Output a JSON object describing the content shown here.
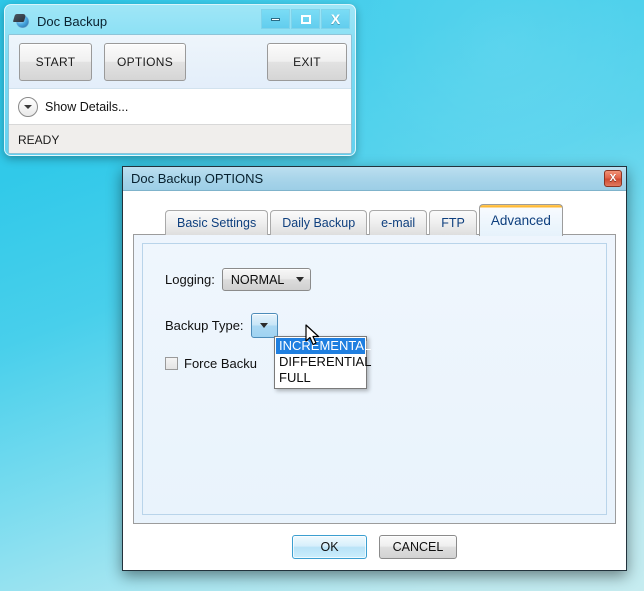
{
  "desktop": {
    "background_top_color": "#2ec7e8",
    "background_bottom_color": "#c6ecf0"
  },
  "main_window": {
    "title": "Doc Backup",
    "icon": "disc-backup-icon",
    "controls": {
      "minimize_label": "Minimize",
      "maximize_label": "Maximize",
      "close_label": "X"
    },
    "buttons": {
      "start": "START",
      "options": "OPTIONS",
      "exit": "EXIT"
    },
    "details_toggle": "Show Details...",
    "status": "READY"
  },
  "options_dialog": {
    "title": "Doc Backup OPTIONS",
    "close_label": "X",
    "tabs": [
      {
        "label": "Basic Settings",
        "active": false
      },
      {
        "label": "Daily Backup",
        "active": false
      },
      {
        "label": "e-mail",
        "active": false
      },
      {
        "label": "FTP",
        "active": false
      },
      {
        "label": "Advanced",
        "active": true
      }
    ],
    "active_tab_accent_color": "#ffb223",
    "fields": {
      "logging_label": "Logging:",
      "logging_value": "NORMAL",
      "backup_type_label": "Backup Type:",
      "backup_type_value": "",
      "force_backup_label": "Force Backu",
      "force_backup_checked": false
    },
    "dropdown": {
      "open": true,
      "highlight_color": "#1f7fe0",
      "options": [
        {
          "label": "INCREMENTAL",
          "selected": true
        },
        {
          "label": "DIFFERENTIAL",
          "selected": false
        },
        {
          "label": "FULL",
          "selected": false
        }
      ]
    },
    "footer": {
      "ok": "OK",
      "cancel": "CANCEL"
    }
  }
}
